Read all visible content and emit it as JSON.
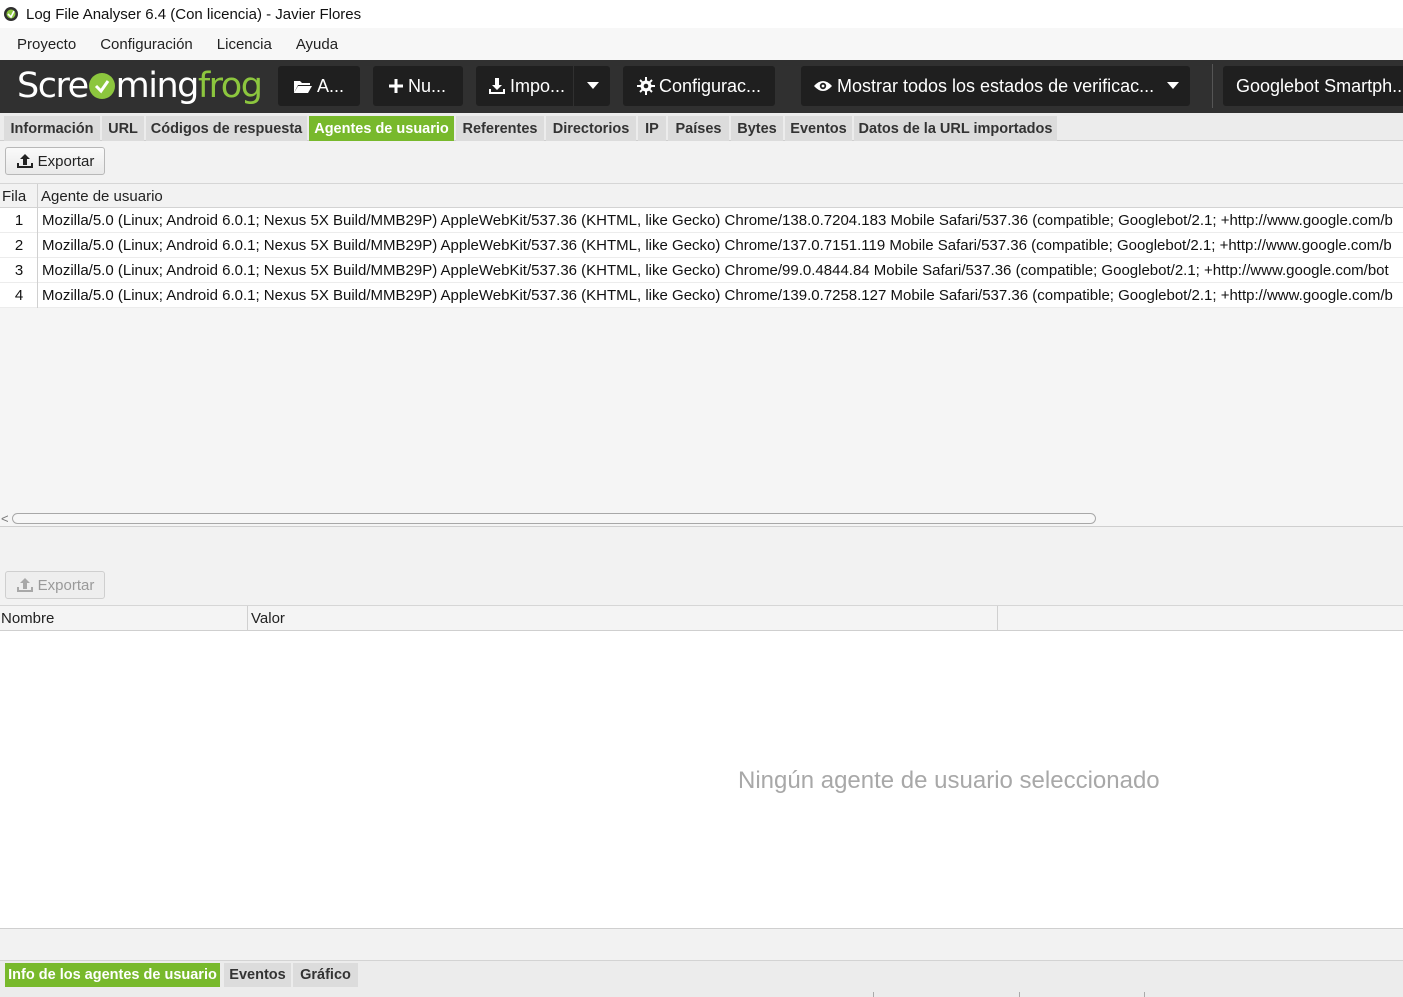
{
  "window": {
    "title": "Log File Analyser 6.4 (Con licencia) - Javier Flores"
  },
  "menu": {
    "items": [
      "Proyecto",
      "Configuración",
      "Licencia",
      "Ayuda"
    ]
  },
  "toolbar": {
    "logo_text_left": "Scre",
    "logo_text_mid": "ming",
    "logo_text_right": "frog",
    "open_label": "A...",
    "new_label": "Nu...",
    "import_label": "Impo...",
    "config_label": "Configurac...",
    "filter_label": "Mostrar todos los estados de verificac...",
    "bot_label": "Googlebot Smartph...",
    "brand_color": "#8cc63e"
  },
  "tabs": {
    "items": [
      "Información",
      "URL",
      "Códigos de respuesta",
      "Agentes de usuario",
      "Referentes",
      "Directorios",
      "IP",
      "Países",
      "Bytes",
      "Eventos",
      "Datos de la URL importados"
    ],
    "active": "Agentes de usuario",
    "active_color": "#78b92c"
  },
  "upper": {
    "export_label": "Exportar",
    "columns": [
      "Fila",
      "Agente de usuario"
    ],
    "rows": [
      {
        "num": "1",
        "ua": "Mozilla/5.0 (Linux; Android 6.0.1; Nexus 5X Build/MMB29P) AppleWebKit/537.36 (KHTML, like Gecko) Chrome/138.0.7204.183 Mobile Safari/537.36 (compatible; Googlebot/2.1; +http://www.google.com/b"
      },
      {
        "num": "2",
        "ua": "Mozilla/5.0 (Linux; Android 6.0.1; Nexus 5X Build/MMB29P) AppleWebKit/537.36 (KHTML, like Gecko) Chrome/137.0.7151.119 Mobile Safari/537.36 (compatible; Googlebot/2.1; +http://www.google.com/b"
      },
      {
        "num": "3",
        "ua": "Mozilla/5.0 (Linux; Android 6.0.1; Nexus 5X Build/MMB29P) AppleWebKit/537.36 (KHTML, like Gecko) Chrome/99.0.4844.84 Mobile Safari/537.36 (compatible; Googlebot/2.1; +http://www.google.com/bot"
      },
      {
        "num": "4",
        "ua": "Mozilla/5.0 (Linux; Android 6.0.1; Nexus 5X Build/MMB29P) AppleWebKit/537.36 (KHTML, like Gecko) Chrome/139.0.7258.127 Mobile Safari/537.36 (compatible; Googlebot/2.1; +http://www.google.com/b"
      }
    ]
  },
  "lower": {
    "export_label": "Exportar",
    "columns": [
      "Nombre",
      "Valor"
    ],
    "empty_message": "Ningún agente de usuario seleccionado"
  },
  "bottom_tabs": {
    "items": [
      "Info de los agentes de usuario",
      "Eventos",
      "Gráfico"
    ],
    "active": "Info de los agentes de usuario"
  }
}
